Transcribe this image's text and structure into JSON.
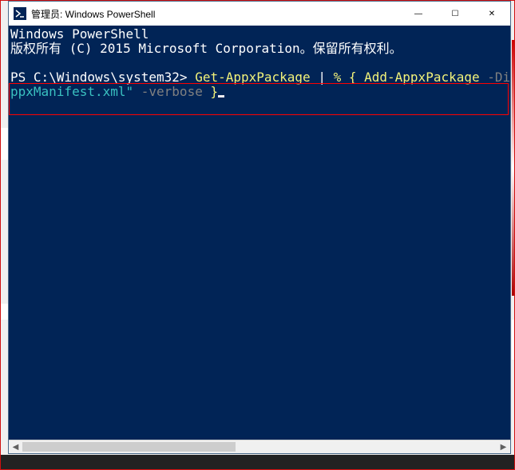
{
  "window": {
    "title": "管理员: Windows PowerShell"
  },
  "controls": {
    "minimize_glyph": "—",
    "maximize_glyph": "☐",
    "close_glyph": "✕"
  },
  "console": {
    "line1": "Windows PowerShell",
    "line2_a": "版权所有 (C) 2015 Microsoft Corporation",
    "line2_b": "。保留所有权利。",
    "prompt": "PS C:\\Windows\\system32> ",
    "cmd_seg1": "Get-AppxPackage",
    "cmd_pipe": " | ",
    "cmd_seg2": "% { ",
    "cmd_seg3": "Add-AppxPackage ",
    "cmd_flag1": "-DisableDevelo",
    "cmd_line2_a": "ppxManifest.xml\" ",
    "cmd_flag2": "-verbose ",
    "cmd_closebrace": "}"
  },
  "scrollbar": {
    "left_glyph": "◀",
    "right_glyph": "▶"
  }
}
